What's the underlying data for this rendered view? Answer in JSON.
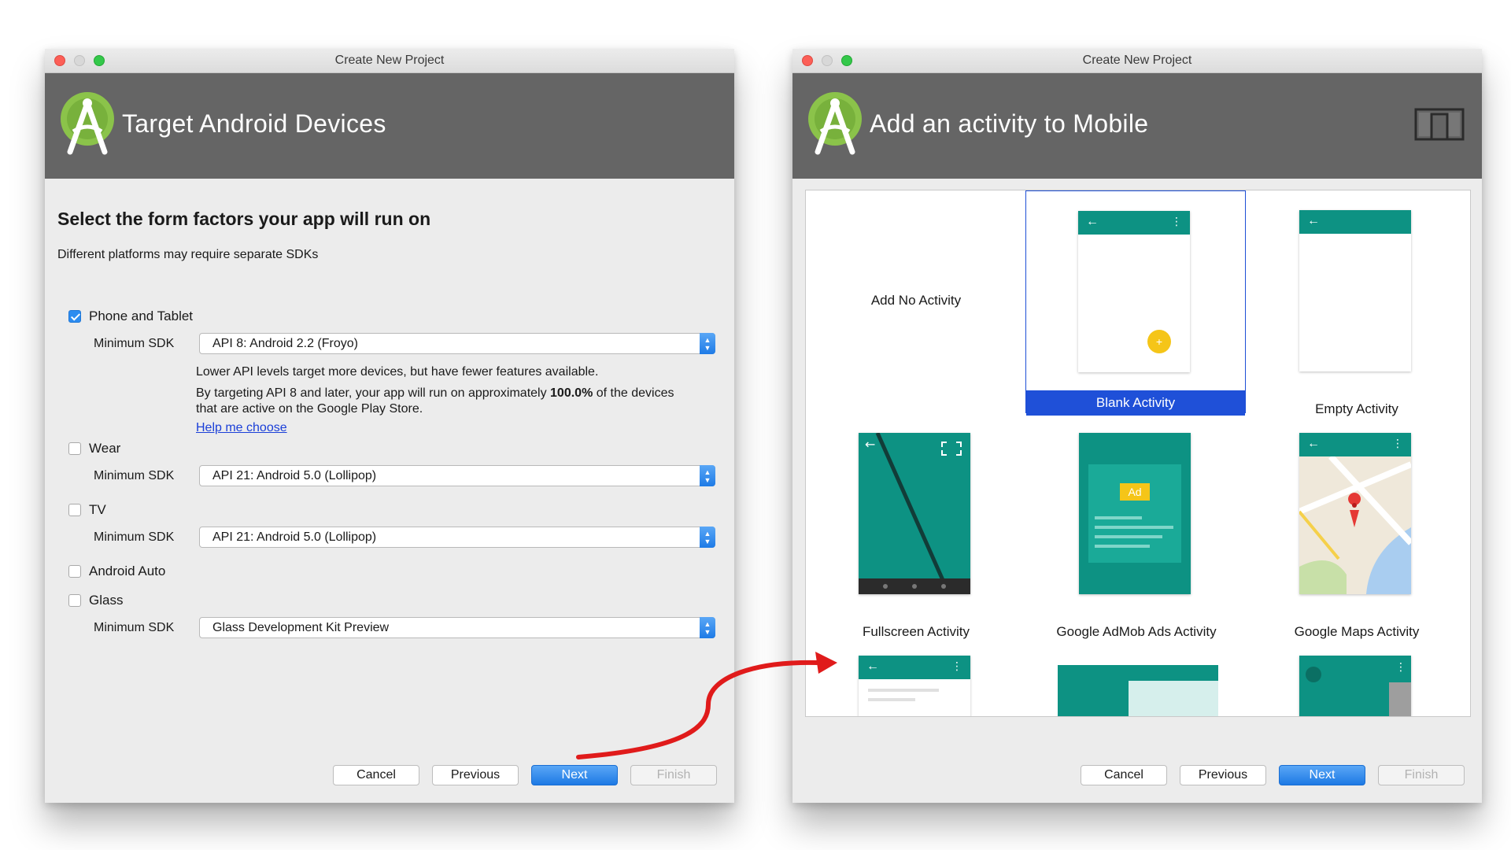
{
  "left_window": {
    "title": "Create New Project",
    "banner_title": "Target Android Devices",
    "heading": "Select the form factors your app will run on",
    "subheading": "Different platforms may require separate SDKs",
    "sdk_label": "Minimum SDK",
    "phone": {
      "label": "Phone and Tablet",
      "checked": true,
      "sdk": "API 8: Android 2.2 (Froyo)",
      "info_1": "Lower API levels target more devices, but have fewer features available.",
      "info_2a": "By targeting API 8 and later, your app will run on approximately ",
      "info_2b": "100.0%",
      "info_2c": " of the devices",
      "info_3": "that are active on the Google Play Store.",
      "help_link": "Help me choose"
    },
    "wear": {
      "label": "Wear",
      "checked": false,
      "sdk": "API 21: Android 5.0 (Lollipop)"
    },
    "tv": {
      "label": "TV",
      "checked": false,
      "sdk": "API 21: Android 5.0 (Lollipop)"
    },
    "auto": {
      "label": "Android Auto",
      "checked": false
    },
    "glass": {
      "label": "Glass",
      "checked": false,
      "sdk": "Glass Development Kit Preview"
    },
    "buttons": {
      "cancel": "Cancel",
      "previous": "Previous",
      "next": "Next",
      "finish": "Finish"
    }
  },
  "right_window": {
    "title": "Create New Project",
    "banner_title": "Add an activity to Mobile",
    "tiles": [
      {
        "label": "Add No Activity"
      },
      {
        "label": "Blank Activity",
        "selected": true
      },
      {
        "label": "Empty Activity"
      },
      {
        "label": "Fullscreen Activity"
      },
      {
        "label": "Google AdMob Ads Activity",
        "ad_badge": "Ad"
      },
      {
        "label": "Google Maps Activity"
      }
    ],
    "buttons": {
      "cancel": "Cancel",
      "previous": "Previous",
      "next": "Next",
      "finish": "Finish"
    }
  },
  "colors": {
    "banner": "#656565",
    "teal": "#0d9283",
    "selection": "#1f50d8",
    "primary_button": "#2d8cf0",
    "arrow_red": "#e01b1b",
    "android_green": "#8bc34a"
  },
  "icons": [
    "android-studio-logo",
    "device-form-factor-icon",
    "back-arrow-icon",
    "overflow-menu-icon",
    "fab-plus-icon",
    "fullscreen-icon",
    "map-pin-icon",
    "red-flow-arrow"
  ]
}
